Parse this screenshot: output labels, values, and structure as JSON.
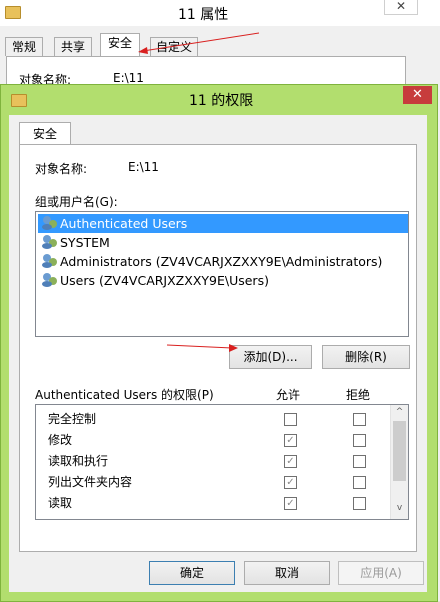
{
  "background_window": {
    "title": "11 属性",
    "close_glyph": "✕",
    "tabs": [
      "常规",
      "共享",
      "安全",
      "自定义"
    ],
    "object_label": "对象名称:",
    "object_value": "E:\\11"
  },
  "dialog": {
    "title": "11 的权限",
    "close_glyph": "✕",
    "tab_label": "安全",
    "object_label": "对象名称:",
    "object_value": "E:\\11",
    "group_label": "组或用户名(G):",
    "users": [
      {
        "name": "Authenticated Users",
        "selected": true
      },
      {
        "name": "SYSTEM",
        "selected": false
      },
      {
        "name": "Administrators (ZV4VCARJXZXXY9E\\Administrators)",
        "selected": false
      },
      {
        "name": "Users (ZV4VCARJXZXXY9E\\Users)",
        "selected": false
      }
    ],
    "add_button": "添加(D)...",
    "remove_button": "删除(R)",
    "permissions_title": "Authenticated Users 的权限(P)",
    "allow_header": "允许",
    "deny_header": "拒绝",
    "permissions": [
      {
        "name": "完全控制",
        "allow": false,
        "deny": false
      },
      {
        "name": "修改",
        "allow": true,
        "deny": false
      },
      {
        "name": "读取和执行",
        "allow": true,
        "deny": false
      },
      {
        "name": "列出文件夹内容",
        "allow": true,
        "deny": false
      },
      {
        "name": "读取",
        "allow": true,
        "deny": false
      }
    ],
    "ok_button": "确定",
    "cancel_button": "取消",
    "apply_button": "应用(A)",
    "check_glyph": "✓",
    "scroll_up_glyph": "^",
    "scroll_down_glyph": "v"
  },
  "colors": {
    "dialog_frame": "#b2de6e",
    "selection": "#3399ff",
    "close_button": "#c73c3c",
    "annotation_arrow": "#d9201f"
  }
}
